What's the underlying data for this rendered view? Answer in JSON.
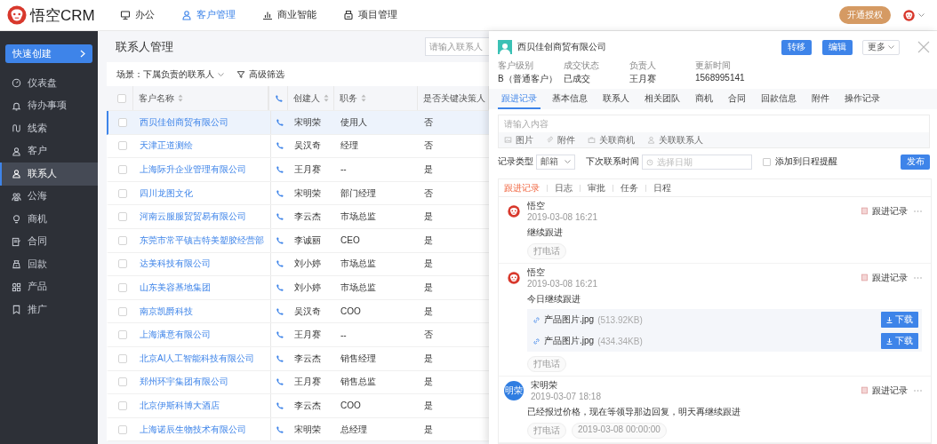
{
  "top_nav": {
    "logo": "悟空CRM",
    "items": [
      {
        "label": "办公",
        "selected": false
      },
      {
        "label": "客户管理",
        "selected": true
      },
      {
        "label": "商业智能",
        "selected": false
      },
      {
        "label": "项目管理",
        "selected": false
      }
    ],
    "license_button": "开通授权"
  },
  "sidebar": {
    "quick_create": "快速创建",
    "items": [
      {
        "label": "仪表盘",
        "selected": false
      },
      {
        "label": "待办事项",
        "selected": false
      },
      {
        "label": "线索",
        "selected": false
      },
      {
        "label": "客户",
        "selected": false
      },
      {
        "label": "联系人",
        "selected": true
      },
      {
        "label": "公海",
        "selected": false
      },
      {
        "label": "商机",
        "selected": false
      },
      {
        "label": "合同",
        "selected": false
      },
      {
        "label": "回款",
        "selected": false
      },
      {
        "label": "产品",
        "selected": false
      },
      {
        "label": "推广",
        "selected": false
      }
    ]
  },
  "main": {
    "title": "联系人管理",
    "search": {
      "placeholder": "请输入联系人"
    },
    "scene": "场景：下属负责的联系人",
    "filter": "高级筛选",
    "table": {
      "select_all": {
        "checked": false
      },
      "columns": [
        "客户名称",
        "创建人",
        "职务",
        "是否关键决策人"
      ],
      "rows": [
        {
          "name": "西贝佳创商贸有限公司",
          "creator": "宋明荣",
          "position": "使用人",
          "decision": "否",
          "selected": true,
          "checked": false
        },
        {
          "name": "天津正道测绘",
          "creator": "吴汉奇",
          "position": "经理",
          "decision": "否",
          "selected": false,
          "checked": false
        },
        {
          "name": "上海际升企业管理有限公司",
          "creator": "王月赛",
          "position": "--",
          "decision": "是",
          "selected": false,
          "checked": false
        },
        {
          "name": "四川龙图文化",
          "creator": "宋明荣",
          "position": "部门经理",
          "decision": "否",
          "selected": false,
          "checked": false
        },
        {
          "name": "河南云服服贸贸易有限公司",
          "creator": "李云杰",
          "position": "市场总监",
          "decision": "是",
          "selected": false,
          "checked": false
        },
        {
          "name": "东莞市常平镇吉特美塑胶经营部",
          "creator": "李诚丽",
          "position": "CEO",
          "decision": "是",
          "selected": false,
          "checked": false
        },
        {
          "name": "达美科技有限公司",
          "creator": "刘小婷",
          "position": "市场总监",
          "decision": "是",
          "selected": false,
          "checked": false
        },
        {
          "name": "山东美容基地集团",
          "creator": "刘小婷",
          "position": "市场总监",
          "decision": "是",
          "selected": false,
          "checked": false
        },
        {
          "name": "南京凯爵科技",
          "creator": "吴汉奇",
          "position": "COO",
          "decision": "是",
          "selected": false,
          "checked": false
        },
        {
          "name": "上海满意有限公司",
          "creator": "王月赛",
          "position": "--",
          "decision": "否",
          "selected": false,
          "checked": false
        },
        {
          "name": "北京AI人工智能科技有限公司",
          "creator": "李云杰",
          "position": "销售经理",
          "decision": "是",
          "selected": false,
          "checked": false
        },
        {
          "name": "郑州环宇集团有限公司",
          "creator": "王月赛",
          "position": "销售总监",
          "decision": "是",
          "selected": false,
          "checked": false
        },
        {
          "name": "北京伊斯科博大酒店",
          "creator": "李云杰",
          "position": "COO",
          "decision": "是",
          "selected": false,
          "checked": false
        },
        {
          "name": "上海诺辰生物技术有限公司",
          "creator": "宋明荣",
          "position": "总经理",
          "decision": "是",
          "selected": false,
          "checked": false
        }
      ]
    }
  },
  "detail": {
    "title": "西贝佳创商贸有限公司",
    "buttons": [
      "转移",
      "编辑"
    ],
    "more": "更多",
    "fields": [
      {
        "label": "客户级别",
        "value": "B（普通客户）"
      },
      {
        "label": "成交状态",
        "value": "已成交"
      },
      {
        "label": "负责人",
        "value": "王月赛"
      },
      {
        "label": "更新时间",
        "value": "1568995141"
      }
    ],
    "tabs": [
      {
        "label": "跟进记录",
        "selected": true
      },
      {
        "label": "基本信息",
        "selected": false
      },
      {
        "label": "联系人",
        "selected": false
      },
      {
        "label": "相关团队",
        "selected": false
      },
      {
        "label": "商机",
        "selected": false
      },
      {
        "label": "合同",
        "selected": false
      },
      {
        "label": "回款信息",
        "selected": false
      },
      {
        "label": "附件",
        "selected": false
      },
      {
        "label": "操作记录",
        "selected": false
      }
    ],
    "composer": {
      "placeholder": "请输入内容",
      "tools": [
        "图片",
        "附件",
        "关联商机",
        "关联联系人"
      ]
    },
    "record_type": {
      "label": "记录类型",
      "value": "邮箱"
    },
    "next_contact": {
      "label": "下次联系时间",
      "placeholder": "选择日期"
    },
    "schedule": {
      "label": "添加到日程提醒",
      "checked": false
    },
    "publish": "发布",
    "subtabs": [
      {
        "label": "跟进记录",
        "selected": true
      },
      {
        "label": "日志",
        "selected": false
      },
      {
        "label": "审批",
        "selected": false
      },
      {
        "label": "任务",
        "selected": false
      },
      {
        "label": "日程",
        "selected": false
      }
    ],
    "records": [
      {
        "avatar": {
          "kind": "logo"
        },
        "author": "悟空",
        "time": "2019-03-08 16:21",
        "type": "跟进记录",
        "content": "继续跟进",
        "tags": [
          "打电话"
        ]
      },
      {
        "avatar": {
          "kind": "logo"
        },
        "author": "悟空",
        "time": "2019-03-08 16:21",
        "type": "跟进记录",
        "content": "今日继续跟进",
        "attachments": [
          {
            "name": "产品图片.jpg",
            "size": "(513.92KB)",
            "button": "下载"
          },
          {
            "name": "产品图片.jpg",
            "size": "(434.34KB)",
            "button": "下载"
          }
        ],
        "tags": [
          "打电话"
        ]
      },
      {
        "avatar": {
          "kind": "initials",
          "text": "明荣"
        },
        "author": "宋明荣",
        "time": "2019-03-07 18:18",
        "type": "跟进记录",
        "content": "已经报过价格，现在等领导那边回复，明天再继续跟进",
        "tags": [
          "打电话",
          "2019-03-08 00:00:00"
        ]
      }
    ]
  }
}
